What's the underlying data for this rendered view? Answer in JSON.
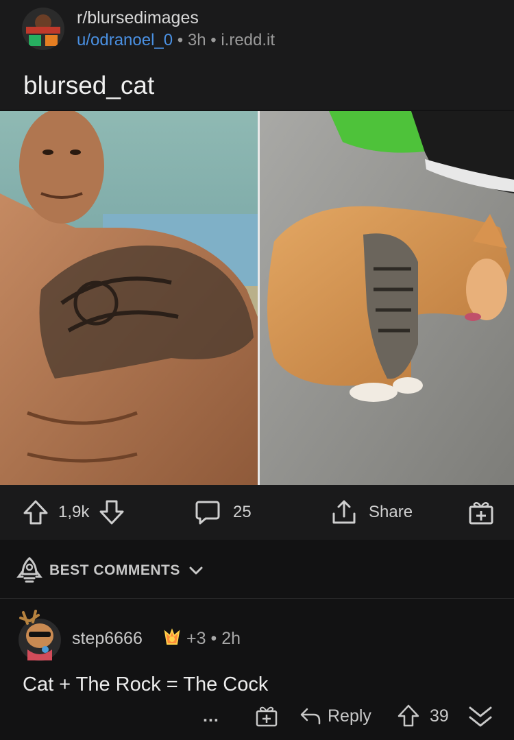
{
  "post": {
    "subreddit": "r/blursedimages",
    "author": "u/odranoel_0",
    "separator": "•",
    "age": "3h",
    "domain": "i.redd.it",
    "title": "blursed_cat"
  },
  "actions": {
    "votes": "1,9k",
    "comments": "25",
    "share_label": "Share"
  },
  "sort": {
    "label": "BEST COMMENTS"
  },
  "comment": {
    "username": "step6666",
    "score": "+3",
    "separator": "•",
    "age": "2h",
    "body": "Cat + The Rock = The Cock",
    "more": "...",
    "reply_label": "Reply",
    "votes": "39"
  },
  "colors": {
    "background": "#121213",
    "card": "#1a1a1b",
    "link": "#4a90e2"
  }
}
